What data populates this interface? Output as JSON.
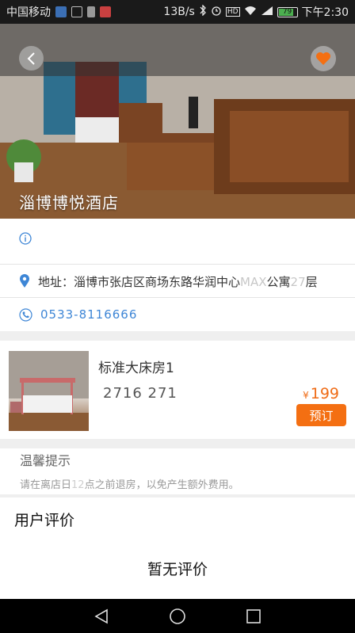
{
  "status_bar": {
    "carrier": "中国移动",
    "speed": "13B/s",
    "battery": "79",
    "time": "下午2:30"
  },
  "hotel": {
    "name": "淄博博悦酒店",
    "address_label": "地址：",
    "address_main": "淄博市张店区商场东路华润中心",
    "address_faded_1": "MAX",
    "address_mid": "公寓",
    "address_faded_2": "27",
    "address_end": "层",
    "phone": "0533-8116666"
  },
  "room": {
    "name": "标准大床房1",
    "code": "2716 271",
    "currency": "¥",
    "price": "199",
    "book_label": "预订"
  },
  "tips": {
    "title": "温馨提示",
    "text_before": "请在离店日",
    "text_faded": "12",
    "text_after": "点之前退房，以免产生额外费用。"
  },
  "reviews": {
    "title": "用户评价",
    "empty": "暂无评价"
  },
  "colors": {
    "accent_orange": "#f46f12",
    "price_orange": "#ef6c17",
    "link_blue": "#3e86d6",
    "icon_blue": "#3e86d6"
  }
}
